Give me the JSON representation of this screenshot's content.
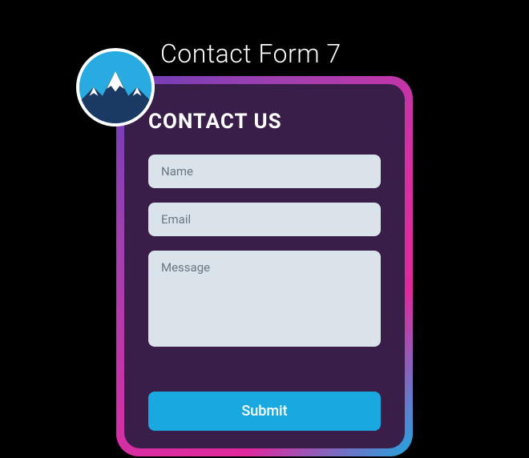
{
  "title": "Contact Form 7",
  "logo": {
    "name": "mountain-logo",
    "colors": {
      "sky": "#29abe2",
      "snow": "#ffffff",
      "rock": "#1b3a63"
    }
  },
  "form": {
    "heading": "CONTACT US",
    "fields": {
      "name": {
        "placeholder": "Name",
        "value": ""
      },
      "email": {
        "placeholder": "Email",
        "value": ""
      },
      "message": {
        "placeholder": "Message",
        "value": ""
      }
    },
    "submit_label": "Submit"
  },
  "colors": {
    "background": "#000000",
    "card_inner": "#3a1e4a",
    "field_bg": "#dbe3ea",
    "submit_bg": "#1aa8e0",
    "gradient": [
      "#6a3eb8",
      "#a13fb0",
      "#d62fa3",
      "#e0289e",
      "#1fa8e0"
    ]
  }
}
